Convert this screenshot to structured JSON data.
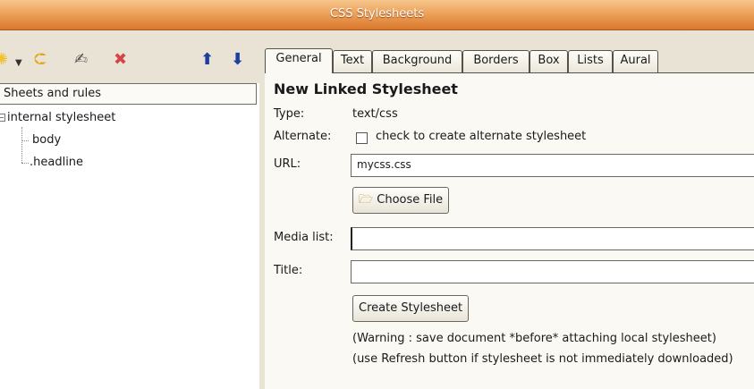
{
  "window": {
    "title": "CSS Stylesheets"
  },
  "toolbar": {
    "icons": [
      "new-rule-icon",
      "dropdown-arrow-icon",
      "import-icon",
      "edit-icon",
      "delete-icon",
      "move-up-icon",
      "move-down-icon"
    ]
  },
  "tree": {
    "header": "Sheets and rules",
    "items": [
      {
        "label": "internal stylesheet"
      },
      {
        "label": "body"
      },
      {
        "label": ".headline"
      }
    ]
  },
  "tabs": [
    {
      "label": "General",
      "active": true
    },
    {
      "label": "Text"
    },
    {
      "label": "Background"
    },
    {
      "label": "Borders"
    },
    {
      "label": "Box"
    },
    {
      "label": "Lists"
    },
    {
      "label": "Aural"
    }
  ],
  "form": {
    "heading": "New Linked Stylesheet",
    "type_label": "Type:",
    "type_value": "text/css",
    "alternate_label": "Alternate:",
    "alternate_checkbox_label": "check to create alternate stylesheet",
    "url_label": "URL:",
    "url_value": "mycss.css",
    "choose_file_label": "Choose File",
    "media_label": "Media list:",
    "media_value": "",
    "title_label": "Title:",
    "title_value": "",
    "create_button_label": "Create Stylesheet",
    "warning_1": "(Warning : save document *before* attaching local stylesheet)",
    "warning_2": "(use Refresh button if stylesheet is not immediately downloaded)"
  },
  "colors": {
    "titlebar": "#e9984d",
    "panel": "#e9e3d6",
    "content": "#fbf9f3"
  }
}
